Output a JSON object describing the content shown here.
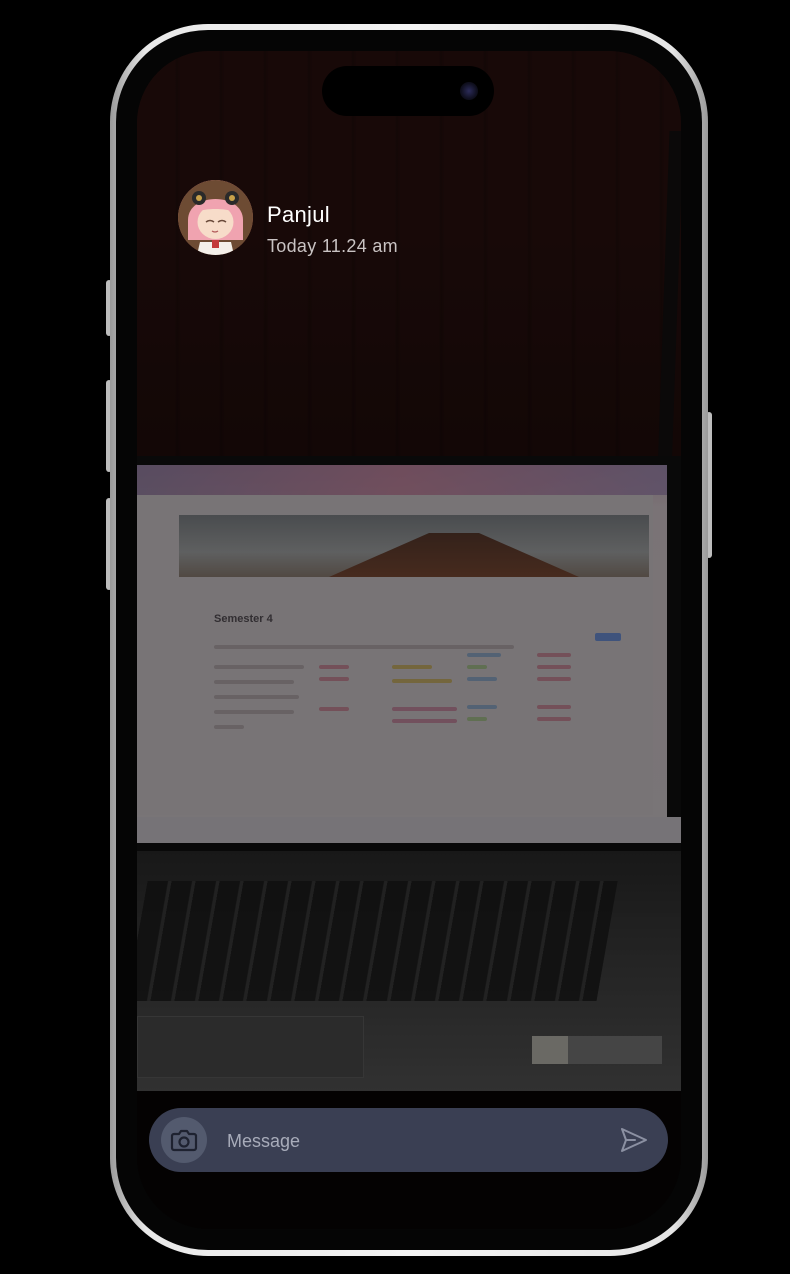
{
  "header": {
    "sender_name": "Panjul",
    "timestamp": "Today 11.24 am"
  },
  "photo": {
    "screen_page_title": "Semester 4"
  },
  "composer": {
    "placeholder": "Message"
  },
  "icons": {
    "camera": "camera-icon",
    "send": "send-icon",
    "avatar": "avatar"
  },
  "colors": {
    "message_bar": "#3a3f53",
    "camera_button": "#535a6e",
    "name_text": "#ffffff",
    "timestamp_text": "#c9c3c3"
  }
}
